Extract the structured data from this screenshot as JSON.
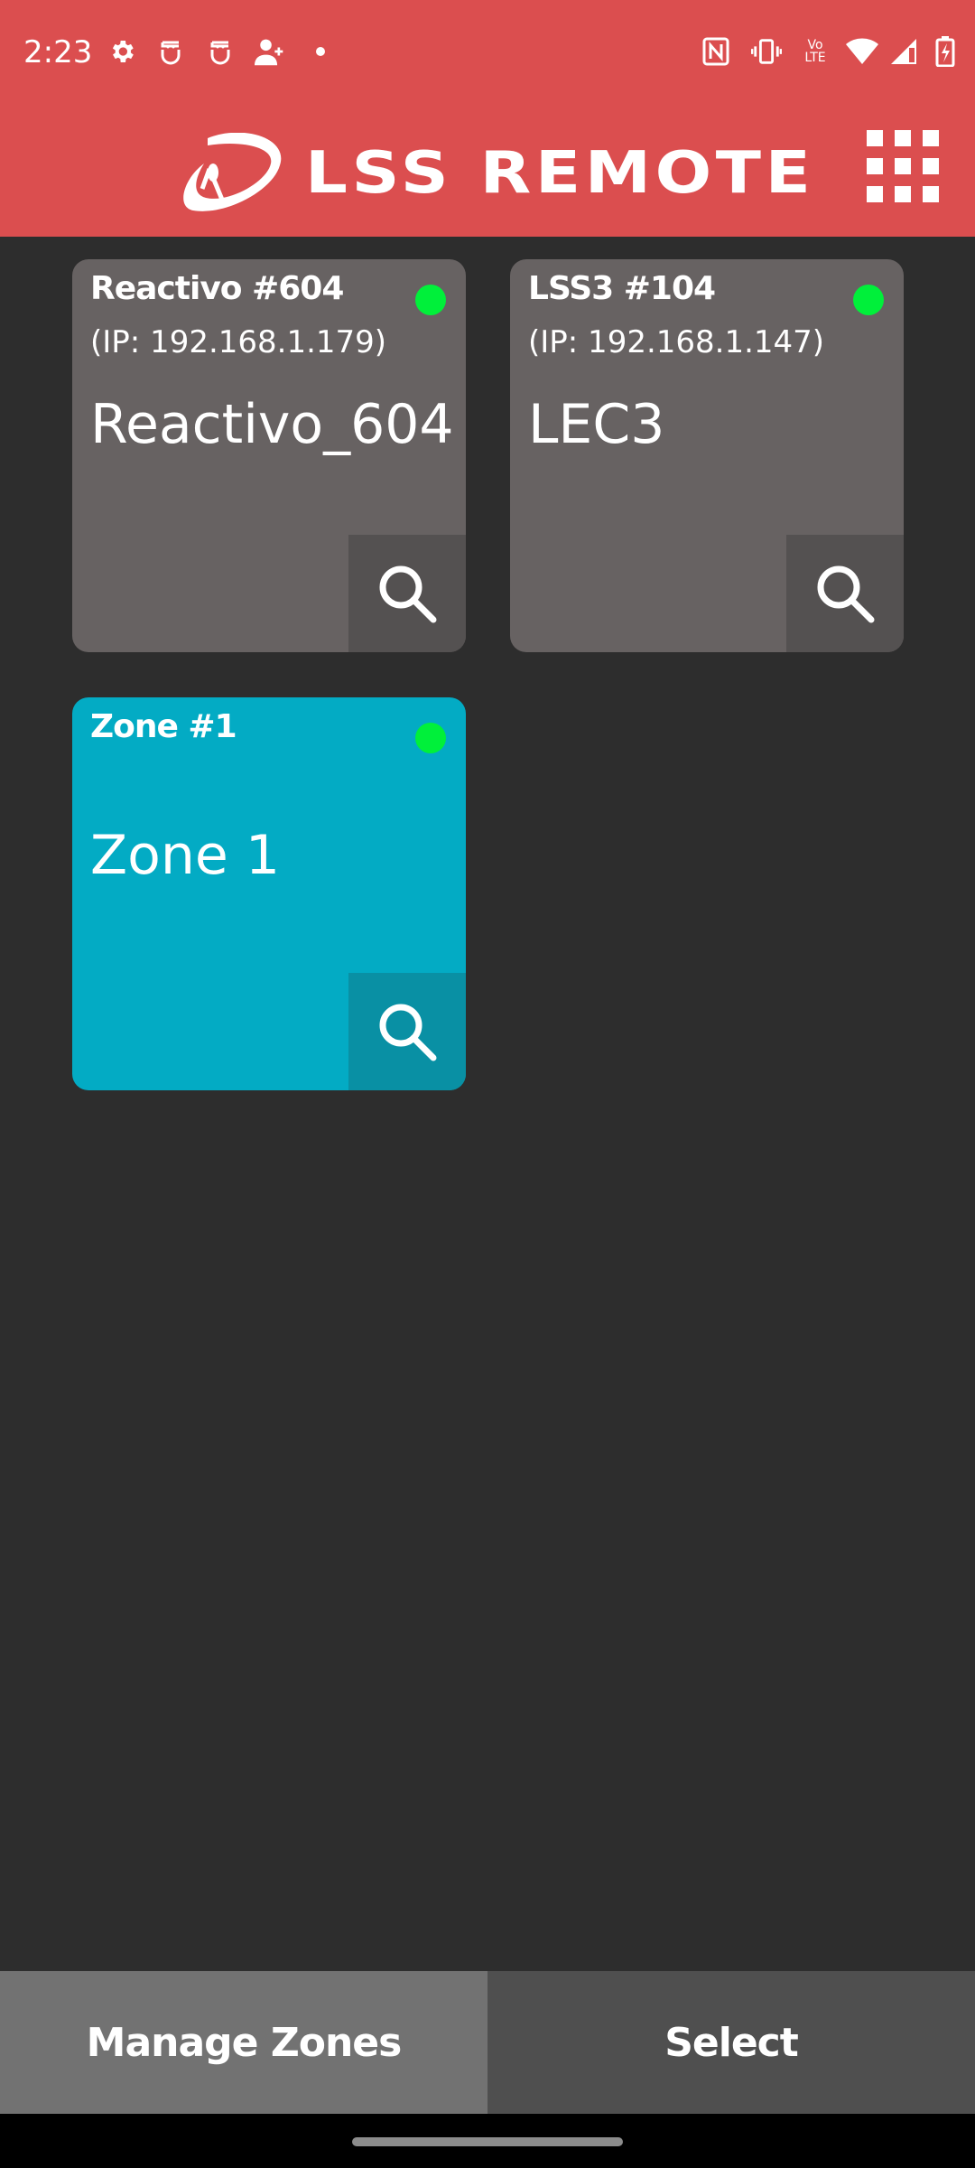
{
  "status_bar": {
    "time": "2:23",
    "left_icons": [
      "gear-icon",
      "android-debug-icon",
      "android-debug-icon",
      "add-contact-icon",
      "notification-dot-icon"
    ],
    "right_icons": [
      "nfc-icon",
      "vibrate-icon",
      "volte-icon",
      "wifi-icon",
      "cell-signal-icon",
      "battery-charging-icon"
    ],
    "volte_label_top": "Vo",
    "volte_label_bottom": "LTE"
  },
  "app_bar": {
    "logo_text": "LSS REMOTE",
    "menu_icon": "grid-menu-icon",
    "background_color": "#db4e4f"
  },
  "devices": [
    {
      "title": "Reactivo #604",
      "ip": "(IP: 192.168.1.179)",
      "name": "Reactivo_604",
      "status": "online",
      "status_color": "#00f03a",
      "color": "#676262"
    },
    {
      "title": "LSS3 #104",
      "ip": "(IP: 192.168.1.147)",
      "name": "LEC3",
      "status": "online",
      "status_color": "#00f03a",
      "color": "#676262"
    },
    {
      "title": "Zone #1",
      "ip": "",
      "name": "Zone 1",
      "status": "online",
      "status_color": "#00f03a",
      "color": "#03abc4"
    }
  ],
  "bottom_bar": {
    "manage_zones_label": "Manage Zones",
    "select_label": "Select"
  }
}
